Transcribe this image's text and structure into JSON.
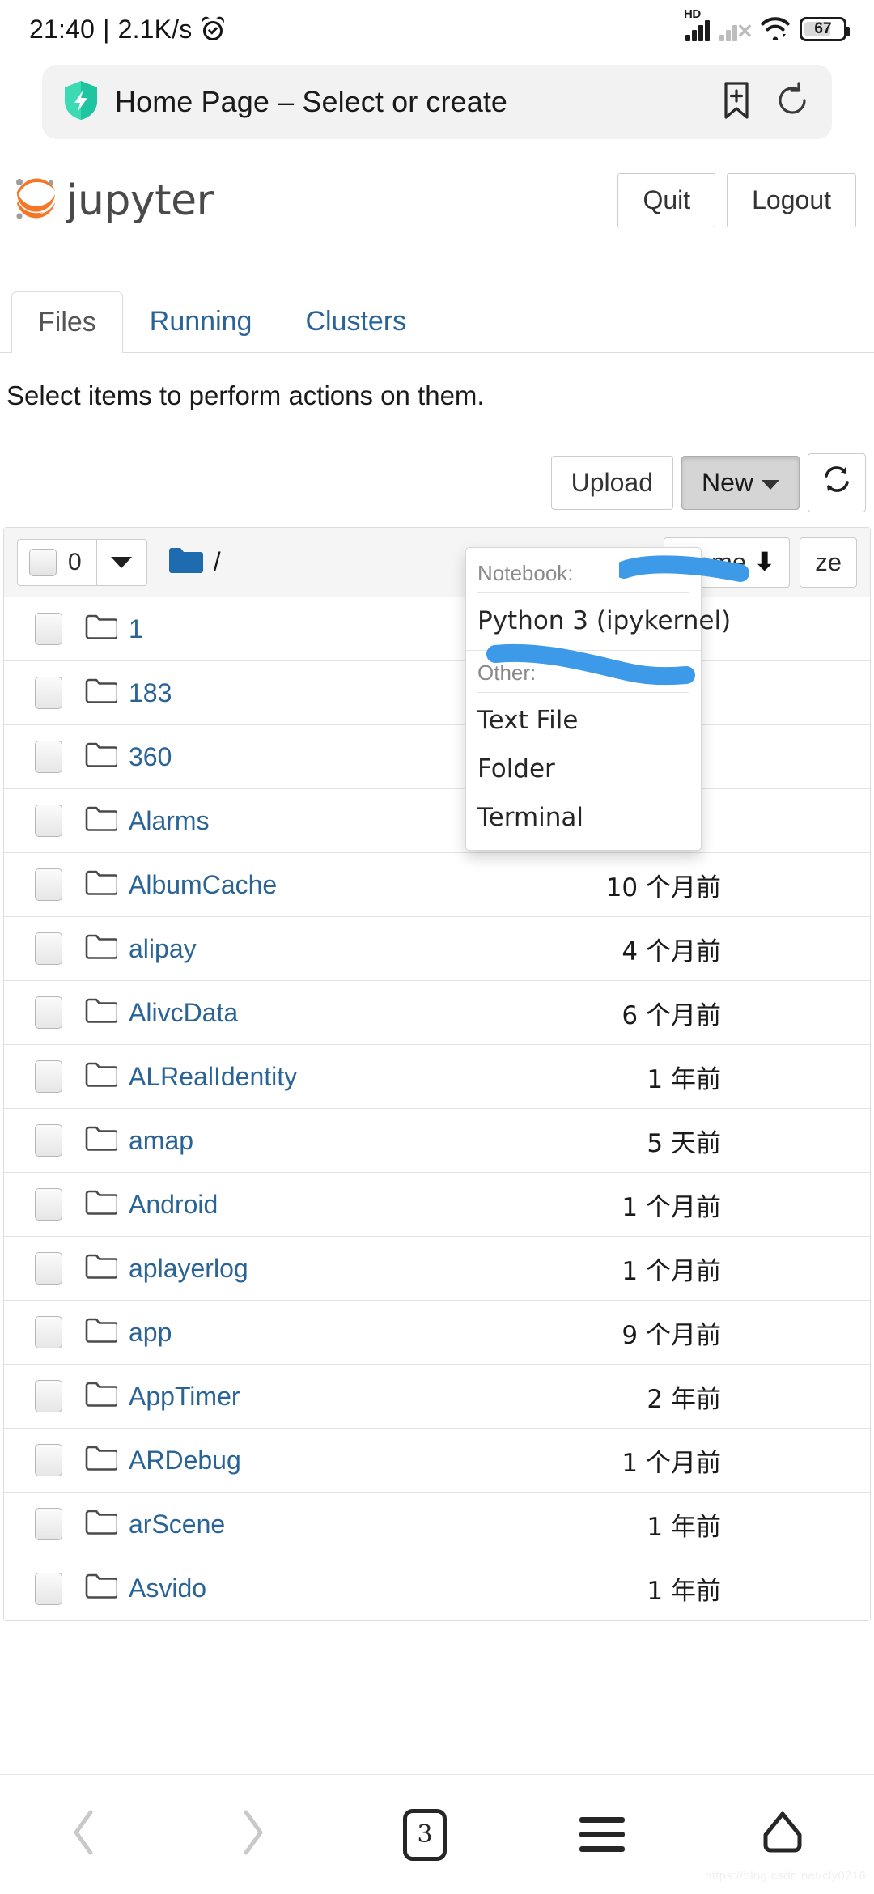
{
  "statusbar": {
    "time": "21:40",
    "separator": "|",
    "network_speed": "2.1K/s",
    "alarm_icon": "alarm-clock-icon",
    "hd_label": "HD",
    "signal_icon": "cellular-signal-icon",
    "signal_off_icon": "cellular-signal-disabled-icon",
    "wifi_icon": "wifi-icon",
    "battery_level": "67"
  },
  "browser": {
    "shield_icon": "shield-lightning-icon",
    "page_title": "Home Page – Select or create",
    "bookmark_icon": "bookmark-add-icon",
    "reload_icon": "reload-icon",
    "bottom_nav": {
      "back_icon": "chevron-left-icon",
      "forward_icon": "chevron-right-icon",
      "tab_count": "3",
      "menu_icon": "hamburger-menu-icon",
      "home_icon": "home-icon"
    },
    "watermark": "https://blog.csdn.net/cly0216"
  },
  "jupyter": {
    "logo_text": "jupyter",
    "logo_icon": "jupyter-logo-icon",
    "header_buttons": [
      {
        "label": "Quit",
        "name": "quit-button"
      },
      {
        "label": "Logout",
        "name": "logout-button"
      }
    ],
    "tabs": [
      {
        "label": "Files",
        "active": true
      },
      {
        "label": "Running",
        "active": false
      },
      {
        "label": "Clusters",
        "active": false
      }
    ],
    "notice": "Select items to perform actions on them.",
    "toolbar": {
      "upload_label": "Upload",
      "new_label": "New",
      "new_caret_icon": "caret-down-icon",
      "refresh_icon": "refresh-icon"
    },
    "new_dropdown": {
      "notebook_label": "Notebook:",
      "notebook_items": [
        "Python 3 (ipykernel)"
      ],
      "other_label": "Other:",
      "other_items": [
        "Text File",
        "Folder",
        "Terminal"
      ]
    },
    "list_header": {
      "select_all_checkbox": "select-all-checkbox",
      "selected_count": "0",
      "dropdown_caret_icon": "caret-down-icon",
      "folder_icon": "folder-filled-icon",
      "breadcrumb_root": "/",
      "sort_label": "Name",
      "sort_arrow_icon": "arrow-down-icon",
      "size_label": "ze"
    },
    "files": [
      {
        "name": "1",
        "time": ""
      },
      {
        "name": "183",
        "time": ""
      },
      {
        "name": "360",
        "time": ""
      },
      {
        "name": "Alarms",
        "time": ""
      },
      {
        "name": "AlbumCache",
        "time": "10 个月前"
      },
      {
        "name": "alipay",
        "time": "4 个月前"
      },
      {
        "name": "AlivcData",
        "time": "6 个月前"
      },
      {
        "name": "ALRealIdentity",
        "time": "1 年前"
      },
      {
        "name": "amap",
        "time": "5 天前"
      },
      {
        "name": "Android",
        "time": "1 个月前"
      },
      {
        "name": "aplayerlog",
        "time": "1 个月前"
      },
      {
        "name": "app",
        "time": "9 个月前"
      },
      {
        "name": "AppTimer",
        "time": "2 年前"
      },
      {
        "name": "ARDebug",
        "time": "1 个月前"
      },
      {
        "name": "arScene",
        "time": "1 年前"
      },
      {
        "name": "Asvido",
        "time": "1 年前"
      }
    ]
  },
  "colors": {
    "link_blue": "#2a6496",
    "jupyter_orange": "#f37726",
    "highlight_blue": "#3d9ae8",
    "shield_teal": "#2fd6b0"
  }
}
